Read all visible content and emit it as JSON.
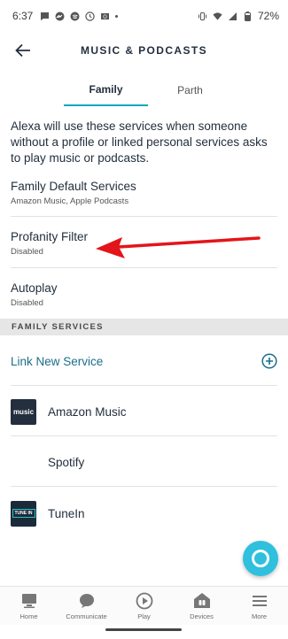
{
  "status_bar": {
    "time": "6:37",
    "battery": "72%"
  },
  "header": {
    "title": "MUSIC & PODCASTS"
  },
  "tabs": [
    {
      "label": "Family",
      "active": true
    },
    {
      "label": "Parth",
      "active": false
    }
  ],
  "intro_text": "Alexa will use these services when someone without a profile or linked personal services asks to play music or podcasts.",
  "settings": [
    {
      "title": "Family Default Services",
      "subtitle": "Amazon Music, Apple Podcasts"
    },
    {
      "title": "Profanity Filter",
      "subtitle": "Disabled"
    },
    {
      "title": "Autoplay",
      "subtitle": "Disabled"
    }
  ],
  "section_header": "FAMILY SERVICES",
  "link_new_service": "Link New Service",
  "services": [
    {
      "name": "Amazon Music",
      "icon": "amazon-music-logo",
      "logo_text": "music"
    },
    {
      "name": "Spotify",
      "icon": "none"
    },
    {
      "name": "TuneIn",
      "icon": "tunein-logo",
      "logo_text": "TUNE IN"
    }
  ],
  "bottom_nav": [
    {
      "label": "Home",
      "icon": "home-icon"
    },
    {
      "label": "Communicate",
      "icon": "communicate-icon"
    },
    {
      "label": "Play",
      "icon": "play-icon"
    },
    {
      "label": "Devices",
      "icon": "devices-icon"
    },
    {
      "label": "More",
      "icon": "more-icon"
    }
  ],
  "colors": {
    "accent": "#00a8bc",
    "link": "#1b6e8a",
    "annotation_arrow": "#e3151a",
    "fab": "#2fc0dd"
  }
}
